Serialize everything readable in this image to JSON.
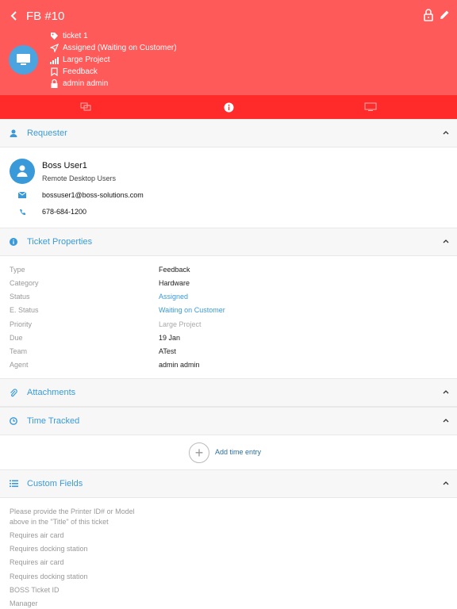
{
  "header": {
    "title": "FB #10",
    "rows": [
      {
        "icon": "tag-icon",
        "text": "ticket 1"
      },
      {
        "icon": "send-icon",
        "text": "Assigned (Waiting on Customer)"
      },
      {
        "icon": "signal-bars-icon",
        "text": "Large Project"
      },
      {
        "icon": "bookmark-icon",
        "text": "Feedback"
      },
      {
        "icon": "lock-icon",
        "text": "admin admin"
      }
    ]
  },
  "tabs": [
    {
      "name": "conversation-tab",
      "icon": "chat-bubbles-icon",
      "active": false
    },
    {
      "name": "info-tab",
      "icon": "info-icon",
      "active": true
    },
    {
      "name": "device-tab",
      "icon": "monitor-icon",
      "active": false
    }
  ],
  "requester": {
    "section_title": "Requester",
    "name": "Boss User1",
    "group": "Remote Desktop Users",
    "email": "bossuser1@boss-solutions.com",
    "phone": "678-684-1200"
  },
  "ticket_properties": {
    "section_title": "Ticket Properties",
    "rows": [
      {
        "label": "Type",
        "value": "Feedback",
        "style": "normal"
      },
      {
        "label": "Category",
        "value": "Hardware",
        "style": "normal"
      },
      {
        "label": "Status",
        "value": "Assigned",
        "style": "blue"
      },
      {
        "label": "E. Status",
        "value": "Waiting on Customer",
        "style": "blue"
      },
      {
        "label": "Priority",
        "value": "Large Project",
        "style": "muted"
      },
      {
        "label": "Due",
        "value": "19 Jan",
        "style": "normal"
      },
      {
        "label": "Team",
        "value": "ATest",
        "style": "normal"
      },
      {
        "label": "Agent",
        "value": "admin admin",
        "style": "normal"
      }
    ]
  },
  "attachments": {
    "section_title": "Attachments"
  },
  "time_tracked": {
    "section_title": "Time Tracked",
    "add_label": "Add time entry",
    "add_symbol": "+"
  },
  "custom_fields": {
    "section_title": "Custom Fields",
    "fields": [
      {
        "line1": "Please provide the Printer ID# or Model",
        "line2": "above in the \"Title\" of this ticket"
      },
      {
        "line1": "Requires air card"
      },
      {
        "line1": "Requires docking station"
      },
      {
        "line1": "Requires air card"
      },
      {
        "line1": "Requires docking station"
      },
      {
        "line1": "BOSS Ticket ID"
      },
      {
        "line1": "Manager"
      }
    ]
  },
  "colors": {
    "header_bg": "#ff5a5a",
    "tabbar_bg": "#ff2a2a",
    "accent_blue": "#3a9ad9",
    "section_bg": "#f7f7f7"
  }
}
